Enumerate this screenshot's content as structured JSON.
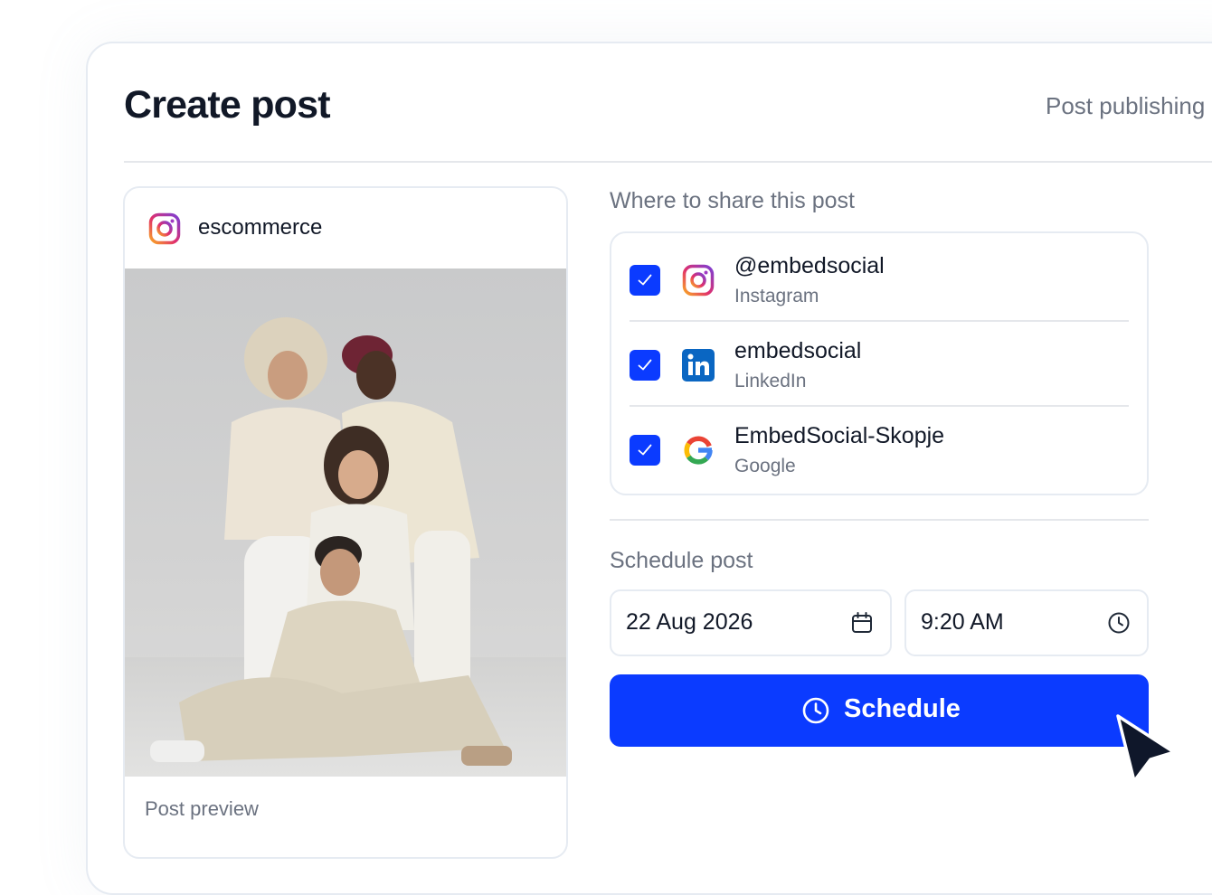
{
  "page": {
    "title": "Create post",
    "header_link": "Post publishing"
  },
  "preview": {
    "account_name": "escommerce",
    "account_icon": "instagram-icon",
    "label": "Post preview"
  },
  "share": {
    "label": "Where to share this post",
    "accounts": [
      {
        "name": "@embedsocial",
        "platform": "Instagram",
        "icon": "instagram-icon",
        "checked": true
      },
      {
        "name": "embedsocial",
        "platform": "LinkedIn",
        "icon": "linkedin-icon",
        "checked": true
      },
      {
        "name": "EmbedSocial-Skopje",
        "platform": "Google",
        "icon": "google-icon",
        "checked": true
      }
    ]
  },
  "schedule": {
    "label": "Schedule post",
    "date_value": "22 Aug 2026",
    "time_value": "9:20 AM",
    "button_label": "Schedule"
  },
  "colors": {
    "accent": "#0b3bff",
    "muted_text": "#6b7280",
    "border": "#e6ebf2"
  }
}
